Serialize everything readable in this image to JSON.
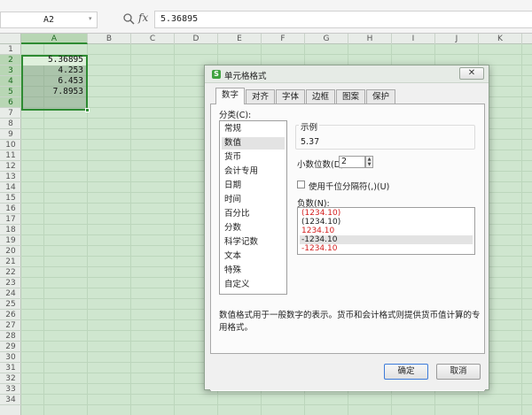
{
  "formula_bar": {
    "name_box": "A2",
    "fx_label": "fx",
    "formula_value": "5.36895"
  },
  "columns": [
    "A",
    "B",
    "C",
    "D",
    "E",
    "F",
    "G",
    "H",
    "I",
    "J",
    "K"
  ],
  "selected_column": "A",
  "rows": [
    "1",
    "2",
    "3",
    "4",
    "5",
    "6",
    "7",
    "8",
    "9",
    "10",
    "11",
    "12",
    "13",
    "14",
    "15",
    "16",
    "17",
    "18",
    "19",
    "20",
    "21",
    "22",
    "23",
    "24",
    "25",
    "26",
    "27",
    "28",
    "29",
    "30",
    "31",
    "32",
    "33",
    "34"
  ],
  "cells": [
    {
      "row": 2,
      "value": "5.36895"
    },
    {
      "row": 3,
      "value": "4.253"
    },
    {
      "row": 4,
      "value": "6.453"
    },
    {
      "row": 5,
      "value": "7.8953"
    }
  ],
  "dialog": {
    "title": "单元格格式",
    "tabs": [
      "数字",
      "对齐",
      "字体",
      "边框",
      "图案",
      "保护"
    ],
    "active_tab": 0,
    "category_label": "分类(C):",
    "categories": [
      "常规",
      "数值",
      "货币",
      "会计专用",
      "日期",
      "时间",
      "百分比",
      "分数",
      "科学记数",
      "文本",
      "特殊",
      "自定义"
    ],
    "selected_category": 1,
    "sample_label": "示例",
    "sample_value": "5.37",
    "decimals_label": "小数位数(D):",
    "decimals_value": "2",
    "thousands_label": "使用千位分隔符(,)(U)",
    "thousands_checked": false,
    "negative_label": "负数(N):",
    "negative_formats": [
      {
        "text": "(1234.10)",
        "color": "#d42020"
      },
      {
        "text": "(1234.10)",
        "color": "#222222"
      },
      {
        "text": "1234.10",
        "color": "#d42020"
      },
      {
        "text": "-1234.10",
        "color": "#222222"
      },
      {
        "text": "-1234.10",
        "color": "#d42020"
      }
    ],
    "selected_negative": 3,
    "description": "数值格式用于一般数字的表示。货币和会计格式则提供货币值计算的专用格式。",
    "ok_label": "确定",
    "cancel_label": "取消"
  },
  "colors": {
    "sheet_background": "#cfe6cf",
    "selection_border": "#2e8b32",
    "negative_red": "#d42020"
  }
}
